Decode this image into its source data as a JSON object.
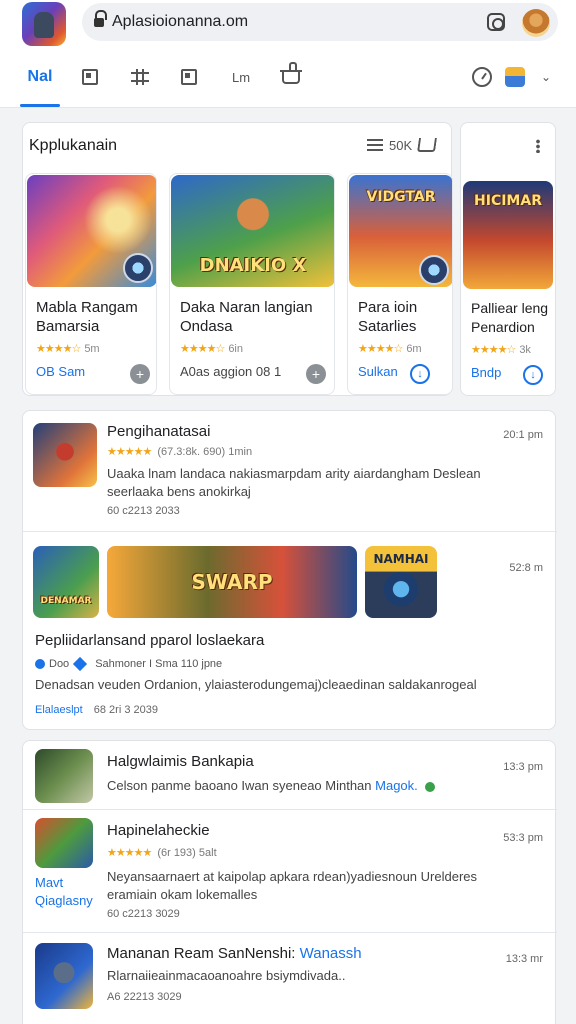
{
  "browser": {
    "url": "Aplasioionanna.om"
  },
  "tabs": {
    "active_label": "Nal",
    "t5_label": "Lm"
  },
  "section": {
    "title": "Kpplukanain",
    "tools_label": "50K"
  },
  "game_cards": [
    {
      "name_line1": "Mabla Rangam",
      "name_line2": "Bamarsia",
      "rating_meta": "5m",
      "link": "OB Sam",
      "thumb_caption": ""
    },
    {
      "name_line1": "Daka Naran langian",
      "name_line2": "Ondasa",
      "rating_meta": "6in",
      "link": "A0as aggion 08 1",
      "thumb_caption": "DNAIKIO X"
    },
    {
      "name_line1": "Para ioin",
      "name_line2": "Satarlies",
      "rating_meta": "6m",
      "link": "Sulkan",
      "thumb_caption": "VIDGTAR"
    },
    {
      "name_line1": "Palliear leng",
      "name_line2": "Penardion",
      "rating_meta": "3k",
      "link": "Bndp",
      "thumb_caption": "HICIMAR"
    }
  ],
  "feed": [
    {
      "title": "Pengihanatasai",
      "rating_meta": "(67.3:8k. 690) 1min",
      "desc_line1": "Uaaka lnam landaca nakiasmarpdam arity aiardangham Deslean",
      "desc_line2": "seerlaaka bens anokirkaj",
      "date": "60 c2213 2033",
      "time": "20:1 pm"
    },
    {
      "title": "Pepliidarlansand pparol loslaekara",
      "banner_caption": "SWARP",
      "thumb_left_caption": "DENAMAR",
      "thumb_right_caption": "NAMHAI",
      "shared_label": "Doo",
      "shared_meta": "Sahmoner I Sma 110 jpne",
      "desc_line1": "Denadsan veuden Ordanion, ylaiasterodungemaj)cleaedinan saldakanrogeal",
      "link": "Elalaeslpt",
      "date": "68 2ri 3 2039",
      "time": "52:8 m"
    },
    {
      "title": "Halgwlaimis Bankapia",
      "desc_line1": "Celson panme baoano Iwan syeneao Minthan",
      "desc_link": "Magok.",
      "time": "13:3 pm"
    },
    {
      "title": "Hapinelaheckie",
      "rating_meta": "(6r 193) 5alt",
      "side_link_line1": "Mavt",
      "side_link_line2": "Qiaglasny",
      "desc_line1": "Neyansaarnaert at kaipolap apkara rdean)yadiesnoun Urelderes",
      "desc_line2": "eramiain okam lokemalles",
      "date": "60 c2213 3029",
      "time": "53:3 pm"
    },
    {
      "title": "Mananan Ream SanNenshi:",
      "title_link": "Wanassh",
      "desc_line1": "Rlarnaiieainmacaoanoahre bsiymdivada..",
      "date": "A6 22213 3029",
      "time": "13:3 mr"
    }
  ]
}
